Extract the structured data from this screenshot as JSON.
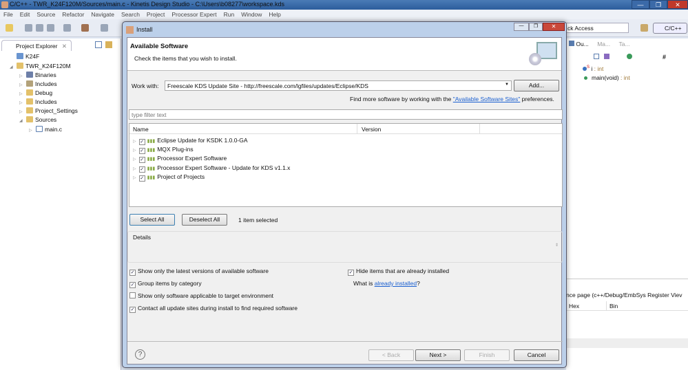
{
  "window": {
    "title": "C/C++ - TWR_K24F120M/Sources/main.c - Kinetis Design Studio - C:\\Users\\b08277\\workspace.kds",
    "min": "—",
    "max": "❐",
    "close": "✕"
  },
  "menu": [
    "File",
    "Edit",
    "Source",
    "Refactor",
    "Navigate",
    "Search",
    "Project",
    "Processor Expert",
    "Run",
    "Window",
    "Help"
  ],
  "quick_access": {
    "value": "ck Access"
  },
  "perspective": "C/C++",
  "project_explorer": {
    "tab": "Project Explorer",
    "close": "✕",
    "items": [
      {
        "label": "K24F",
        "depth": 0,
        "arrow": ""
      },
      {
        "label": "TWR_K24F120M",
        "depth": 0,
        "arrow": "◢"
      },
      {
        "label": "Binaries",
        "depth": 1,
        "arrow": "▷"
      },
      {
        "label": "Includes",
        "depth": 1,
        "arrow": "▷"
      },
      {
        "label": "Debug",
        "depth": 1,
        "arrow": "▷"
      },
      {
        "label": "Includes",
        "depth": 1,
        "arrow": "▷"
      },
      {
        "label": "Project_Settings",
        "depth": 1,
        "arrow": "▷"
      },
      {
        "label": "Sources",
        "depth": 1,
        "arrow": "◢"
      },
      {
        "label": "main.c",
        "depth": 2,
        "arrow": "▷"
      }
    ]
  },
  "outline": {
    "tabs": [
      "Ou...",
      "Ma...",
      "Ta..."
    ],
    "items": [
      {
        "name": "i",
        "type": " : int",
        "badge": "S"
      },
      {
        "name": "main(void)",
        "type": " : int"
      }
    ]
  },
  "register_view": {
    "title": "nce page (c++/Debug/EmbSys Register Viev",
    "columns": [
      "Hex",
      "Bin"
    ]
  },
  "dialog": {
    "title": "Install",
    "heading": "Available Software",
    "subheading": "Check the items that you wish to install.",
    "work_with_label": "Work with:",
    "work_with_value": "Freescale KDS Update Site - http://freescale.com/lgfiles/updates/Eclipse/KDS",
    "add_button": "Add...",
    "find_more_prefix": "Find more software by working with the ",
    "find_more_link": "\"Available Software Sites\"",
    "find_more_suffix": " preferences.",
    "filter_placeholder": "type filter text",
    "columns": [
      "Name",
      "Version"
    ],
    "items": [
      {
        "label": "Eclipse Update for KSDK 1.0.0-GA",
        "checked": true
      },
      {
        "label": "MQX Plug-ins",
        "checked": true
      },
      {
        "label": "Processor Expert Software",
        "checked": true
      },
      {
        "label": "Processor Expert Software - Update for KDS v1.1.x",
        "checked": true
      },
      {
        "label": "Project of Projects",
        "checked": true
      }
    ],
    "select_all": "Select All",
    "deselect_all": "Deselect All",
    "selection_status": "1 item selected",
    "details_label": "Details",
    "options": [
      {
        "label": "Show only the latest versions of available software",
        "checked": true
      },
      {
        "label": "Group items by category",
        "checked": true
      },
      {
        "label": "Show only software applicable to target environment",
        "checked": false
      },
      {
        "label": "Contact all update sites during install to find required software",
        "checked": true
      }
    ],
    "hide_installed": {
      "label": "Hide items that are already installed",
      "checked": true
    },
    "what_is_prefix": "What is ",
    "what_is_link": "already installed",
    "what_is_suffix": "?",
    "help": "?",
    "back": "< Back",
    "next": "Next >",
    "finish": "Finish",
    "cancel": "Cancel"
  }
}
